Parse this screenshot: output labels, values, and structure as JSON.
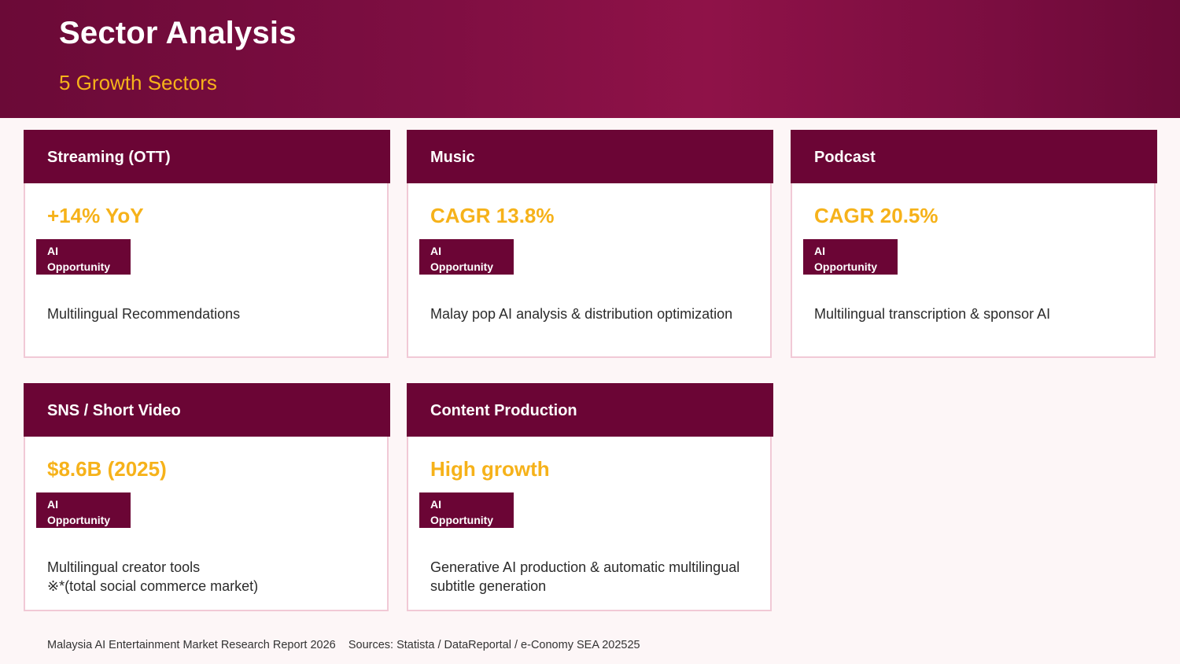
{
  "header": {
    "title": "Sector Analysis",
    "subtitle": "5 Growth Sectors"
  },
  "badge_label": "AI Opportunity",
  "cards": [
    {
      "name": "Streaming (OTT)",
      "metric": "+14% YoY",
      "badge_line1": "AI",
      "badge_line2": "Opportunity",
      "desc_line1": "Multilingual Recommendations",
      "desc_line2": ""
    },
    {
      "name": "Music",
      "metric": "CAGR 13.8%",
      "badge_line1": "AI",
      "badge_line2": "Opportunity",
      "desc_line1": "Malay pop AI analysis & distribution optimization",
      "desc_line2": ""
    },
    {
      "name": "Podcast",
      "metric": "CAGR 20.5%",
      "badge_line1": "AI",
      "badge_line2": "Opportunity",
      "desc_line1": "Multilingual transcription & sponsor AI",
      "desc_line2": ""
    },
    {
      "name": "SNS / Short Video",
      "metric": "$8.6B (2025)",
      "badge_line1": "AI",
      "badge_line2": "Opportunity",
      "desc_line1": "Multilingual creator tools",
      "desc_line2": "※*(total social commerce market)"
    },
    {
      "name": "Content Production",
      "metric": "High growth",
      "badge_line1": "AI",
      "badge_line2": "Opportunity",
      "desc_line1": "Generative AI production & automatic multilingual",
      "desc_line2": "subtitle generation"
    }
  ],
  "footer": {
    "report": "Malaysia AI Entertainment Market Research Report 2026",
    "sources": "Sources: Statista / DataReportal / e-Conomy SEA 202525"
  },
  "colors": {
    "brand": "#6b0535",
    "accent": "#f6b21a",
    "card_border": "#f1c9d6"
  }
}
